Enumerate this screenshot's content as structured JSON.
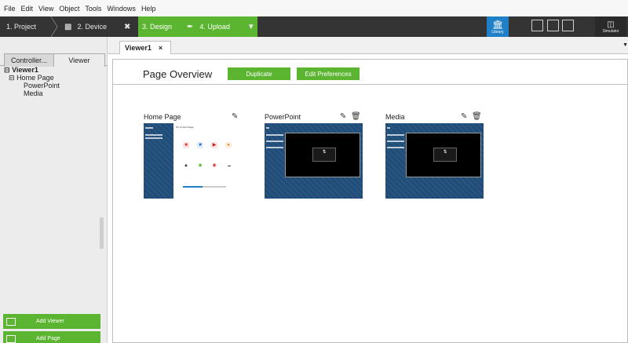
{
  "menu": [
    "File",
    "Edit",
    "View",
    "Object",
    "Tools",
    "Windows",
    "Help"
  ],
  "toolbar": {
    "steps": [
      {
        "label": "1. Project"
      },
      {
        "label": "2. Device"
      },
      {
        "label": "3. Design"
      },
      {
        "label": "4. Upload"
      }
    ],
    "library_label": "Library",
    "simulator_label": "Simulator"
  },
  "left_panel": {
    "tabs": [
      "Controller...",
      "Viewer"
    ],
    "tree": {
      "root": "Viewer1",
      "node": "Home Page",
      "leaves": [
        "PowerPoint",
        "Media"
      ]
    },
    "buttons": [
      "Add Viewer",
      "Add Page"
    ]
  },
  "main": {
    "tab_label": "Viewer1",
    "tab_close": "×",
    "overview_title": "Page Overview",
    "duplicate_label": "Duplicate",
    "edit_preferences_label": "Edit Preferences",
    "pages": [
      {
        "name": "Home Page",
        "panel_title": "PC Control Page"
      },
      {
        "name": "PowerPoint"
      },
      {
        "name": "Media"
      }
    ]
  },
  "colors": {
    "accent_green": "#5cb531",
    "library_blue": "#1f7fc7",
    "toolbar_dark": "#343434",
    "thumb_blue": "#1f4c78"
  }
}
